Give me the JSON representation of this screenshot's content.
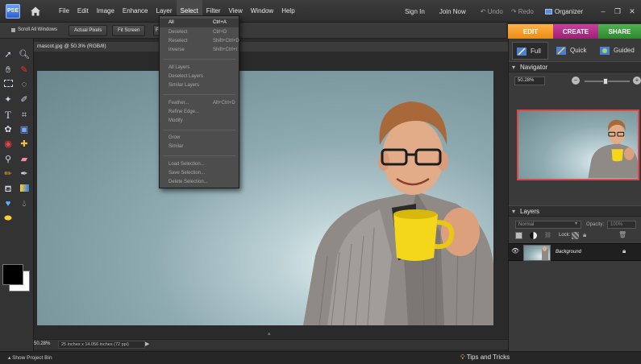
{
  "app": {
    "logo_text": "PSE"
  },
  "menu": [
    "File",
    "Edit",
    "Image",
    "Enhance",
    "Layer",
    "Select",
    "Filter",
    "View",
    "Window",
    "Help"
  ],
  "menu_active": "Select",
  "top_right": {
    "sign_in": "Sign In",
    "join_now": "Join Now",
    "undo": "Undo",
    "redo": "Redo",
    "organizer": "Organizer"
  },
  "options_bar": {
    "scroll_all": "Scroll All Windows",
    "actual_pixels": "Actual Pixels",
    "fit_screen": "Fit Screen",
    "fourth": "F"
  },
  "modes": {
    "edit": "EDIT",
    "create": "CREATE",
    "share": "SHARE",
    "edit_color": "#f39a1f",
    "create_color": "#b42d8a",
    "share_color": "#3a9a3a"
  },
  "views": {
    "full": "Full",
    "quick": "Quick",
    "guided": "Guided"
  },
  "document": {
    "tab_title": "mascot.jpg @ 50.3% (RGB/8)",
    "zoom": "50.28%",
    "dimensions": "25 inches x 14.056 inches (72 ppi)"
  },
  "select_menu": {
    "items": [
      {
        "label": "All",
        "shortcut": "Ctrl+A"
      },
      {
        "label": "Deselect",
        "shortcut": "Ctrl+D"
      },
      {
        "label": "Reselect",
        "shortcut": "Shift+Ctrl+D"
      },
      {
        "label": "Inverse",
        "shortcut": "Shift+Ctrl+I"
      },
      {
        "label": "All Layers",
        "shortcut": ""
      },
      {
        "label": "Deselect Layers",
        "shortcut": ""
      },
      {
        "label": "Similar Layers",
        "shortcut": ""
      },
      {
        "label": "Feather...",
        "shortcut": "Alt+Ctrl+D"
      },
      {
        "label": "Refine Edge...",
        "shortcut": ""
      },
      {
        "label": "Modify",
        "shortcut": ""
      },
      {
        "label": "Grow",
        "shortcut": ""
      },
      {
        "label": "Similar",
        "shortcut": ""
      },
      {
        "label": "Load Selection...",
        "shortcut": ""
      },
      {
        "label": "Save Selection...",
        "shortcut": ""
      },
      {
        "label": "Delete Selection...",
        "shortcut": ""
      }
    ]
  },
  "navigator": {
    "title": "Navigator",
    "zoom": "50.28%",
    "slider_position": 0.45
  },
  "layers": {
    "title": "Layers",
    "blend_mode": "Normal",
    "opacity_label": "Opacity:",
    "opacity_value": "100%",
    "lock_label": "Lock:",
    "layer_name": "Background"
  },
  "bottom": {
    "show_project_bin": "Show Project Bin",
    "tips": "Tips and Tricks"
  }
}
